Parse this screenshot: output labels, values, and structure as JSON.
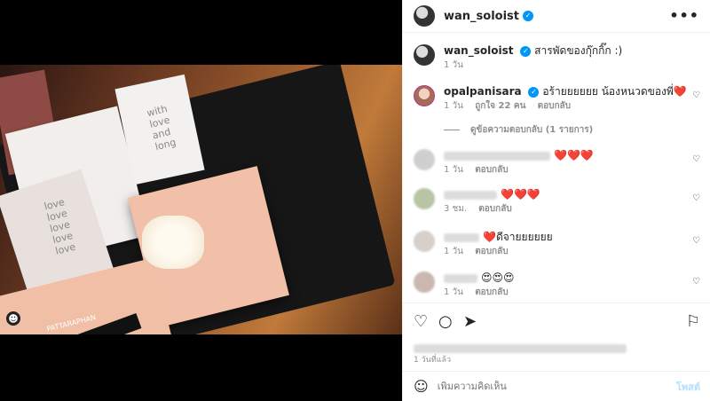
{
  "post": {
    "username": "wan_soloist",
    "caption": "สารพัดของกุ๊กกิ๊ก :)",
    "caption_time": "1 วัน",
    "time_ago": "1 วันที่แล้ว"
  },
  "header": {
    "more_icon": "more-horizontal-icon",
    "more_label": "•••"
  },
  "comments": [
    {
      "username": "opalpanisara",
      "verified": true,
      "text": "อร้ายยยยยย น้องหนวดของพี่",
      "emoji": "❤️",
      "time": "1 วัน",
      "likes": "ถูกใจ 22 คน",
      "reply": "ตอบกลับ",
      "view_replies": "ดูข้อความตอบกลับ (1 รายการ)"
    },
    {
      "username": "",
      "text": "",
      "emoji": "❤️❤️❤️",
      "time": "1 วัน",
      "reply": "ตอบกลับ"
    },
    {
      "username": "",
      "text": "",
      "emoji": "❤️❤️❤️",
      "time": "3 ชม.",
      "reply": "ตอบกลับ"
    },
    {
      "username": "",
      "text": "ดีจายยยยยย",
      "emoji": "❤️",
      "time": "1 วัน",
      "reply": "ตอบกลับ"
    },
    {
      "username": "",
      "text": "",
      "emoji": "😍😍😍",
      "time": "1 วัน",
      "reply": "ตอบกลับ"
    }
  ],
  "compose": {
    "placeholder": "เพิ่มความคิดเห็น",
    "post_label": "โพสต์",
    "emoji": "☺"
  },
  "photo": {
    "card_text_1": "love\nlove\nlove\nlove\nlove",
    "card_text_2": "with\nlove\nand\nlong",
    "brand": "PATTARAPHAN"
  }
}
